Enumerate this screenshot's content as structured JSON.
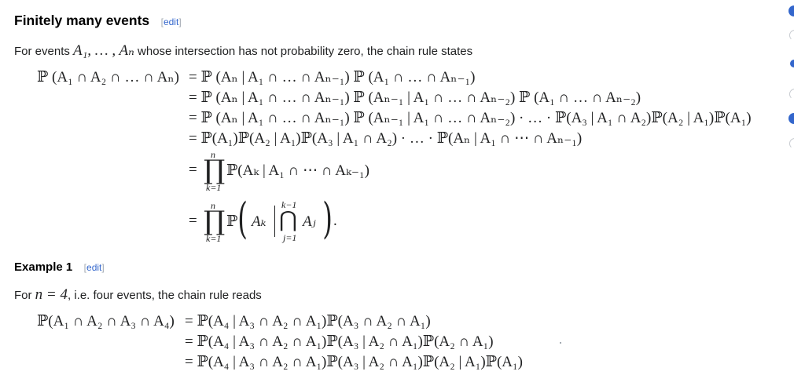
{
  "section": {
    "title": "Finitely many events",
    "edit_open": "[",
    "edit_label": "edit",
    "edit_close": "]"
  },
  "intro": {
    "before": "For events ",
    "math": "A₁, … , Aₙ",
    "after": " whose intersection has not probability zero, the chain rule states"
  },
  "equations": {
    "lhs": "ℙ (A₁ ∩ A₂ ∩ … ∩ Aₙ)",
    "lines": [
      "= ℙ (Aₙ | A₁ ∩ … ∩ Aₙ₋₁) ℙ (A₁ ∩ … ∩ Aₙ₋₁)",
      "= ℙ (Aₙ | A₁ ∩ … ∩ Aₙ₋₁) ℙ (Aₙ₋₁ | A₁ ∩ … ∩ Aₙ₋₂) ℙ (A₁ ∩ … ∩ Aₙ₋₂)",
      "= ℙ (Aₙ | A₁ ∩ … ∩ Aₙ₋₁) ℙ (Aₙ₋₁ | A₁ ∩ … ∩ Aₙ₋₂) · … · ℙ(A₃ | A₁ ∩ A₂)ℙ(A₂ | A₁)ℙ(A₁)",
      "= ℙ(A₁)ℙ(A₂ | A₁)ℙ(A₃ | A₁ ∩ A₂) · … · ℙ(Aₙ | A₁ ∩ ⋯ ∩ Aₙ₋₁)"
    ],
    "prod_line1": "ℙ(Aₖ | A₁ ∩ ⋯ ∩ Aₖ₋₁)",
    "prod_upper": "n",
    "prod_lower": "k=1",
    "cap_upper": "k−1",
    "cap_lower": "j=1",
    "prod_line2_P": "ℙ",
    "prod_line2_Ak": "Aₖ",
    "prod_line2_Aj": "Aⱼ",
    "period": "."
  },
  "example": {
    "title": "Example 1",
    "edit_open": "[",
    "edit_label": "edit",
    "edit_close": "]",
    "text_before": "For ",
    "math": "n = 4",
    "text_after": ", i.e. four events, the chain rule reads",
    "lhs": "ℙ(A₁ ∩ A₂ ∩ A₃ ∩ A₄)",
    "lines": [
      "= ℙ(A₄ | A₃ ∩ A₂ ∩ A₁)ℙ(A₃ ∩ A₂ ∩ A₁)",
      "= ℙ(A₄ | A₃ ∩ A₂ ∩ A₁)ℙ(A₃ | A₂ ∩ A₁)ℙ(A₂ ∩ A₁)",
      "= ℙ(A₄ | A₃ ∩ A₂ ∩ A₁)ℙ(A₃ | A₂ ∩ A₁)ℙ(A₂ | A₁)ℙ(A₁)"
    ]
  },
  "colors": {
    "link": "#3366cc",
    "text": "#202122",
    "edit_bracket": "#a2a9b1",
    "edge_marker": "#3366cc"
  }
}
